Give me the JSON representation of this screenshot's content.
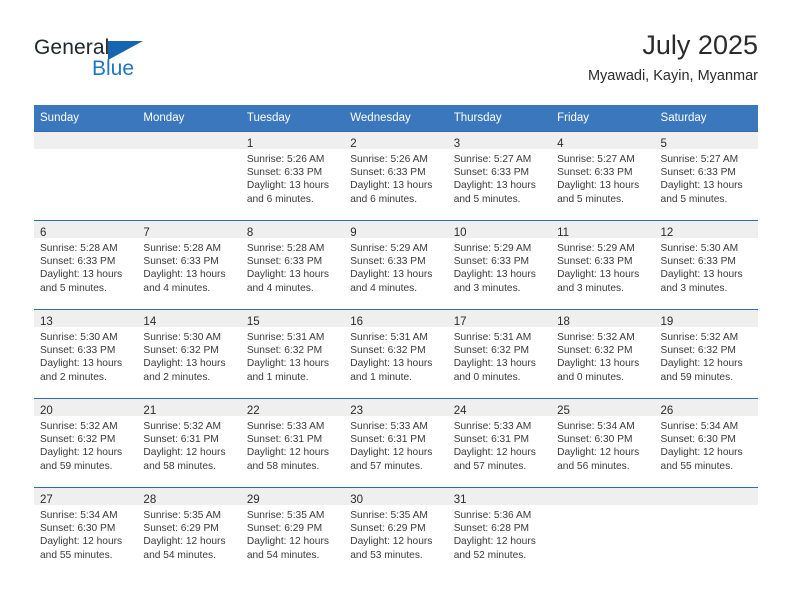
{
  "brand": {
    "name_part1": "General",
    "name_part2": "Blue",
    "triangle_icon": "triangle-icon",
    "accent_color": "#1d77c4"
  },
  "header": {
    "month_title": "July 2025",
    "location": "Myawadi, Kayin, Myanmar"
  },
  "calendar": {
    "header_color": "#3b77bc",
    "separator_color": "#2f6cad",
    "daynum_band_color": "#efefef",
    "weekday_headers": [
      "Sunday",
      "Monday",
      "Tuesday",
      "Wednesday",
      "Thursday",
      "Friday",
      "Saturday"
    ],
    "weeks": [
      [
        {
          "day": "",
          "lines": []
        },
        {
          "day": "",
          "lines": []
        },
        {
          "day": "1",
          "lines": [
            "Sunrise: 5:26 AM",
            "Sunset: 6:33 PM",
            "Daylight: 13 hours",
            "and 6 minutes."
          ]
        },
        {
          "day": "2",
          "lines": [
            "Sunrise: 5:26 AM",
            "Sunset: 6:33 PM",
            "Daylight: 13 hours",
            "and 6 minutes."
          ]
        },
        {
          "day": "3",
          "lines": [
            "Sunrise: 5:27 AM",
            "Sunset: 6:33 PM",
            "Daylight: 13 hours",
            "and 5 minutes."
          ]
        },
        {
          "day": "4",
          "lines": [
            "Sunrise: 5:27 AM",
            "Sunset: 6:33 PM",
            "Daylight: 13 hours",
            "and 5 minutes."
          ]
        },
        {
          "day": "5",
          "lines": [
            "Sunrise: 5:27 AM",
            "Sunset: 6:33 PM",
            "Daylight: 13 hours",
            "and 5 minutes."
          ]
        }
      ],
      [
        {
          "day": "6",
          "lines": [
            "Sunrise: 5:28 AM",
            "Sunset: 6:33 PM",
            "Daylight: 13 hours",
            "and 5 minutes."
          ]
        },
        {
          "day": "7",
          "lines": [
            "Sunrise: 5:28 AM",
            "Sunset: 6:33 PM",
            "Daylight: 13 hours",
            "and 4 minutes."
          ]
        },
        {
          "day": "8",
          "lines": [
            "Sunrise: 5:28 AM",
            "Sunset: 6:33 PM",
            "Daylight: 13 hours",
            "and 4 minutes."
          ]
        },
        {
          "day": "9",
          "lines": [
            "Sunrise: 5:29 AM",
            "Sunset: 6:33 PM",
            "Daylight: 13 hours",
            "and 4 minutes."
          ]
        },
        {
          "day": "10",
          "lines": [
            "Sunrise: 5:29 AM",
            "Sunset: 6:33 PM",
            "Daylight: 13 hours",
            "and 3 minutes."
          ]
        },
        {
          "day": "11",
          "lines": [
            "Sunrise: 5:29 AM",
            "Sunset: 6:33 PM",
            "Daylight: 13 hours",
            "and 3 minutes."
          ]
        },
        {
          "day": "12",
          "lines": [
            "Sunrise: 5:30 AM",
            "Sunset: 6:33 PM",
            "Daylight: 13 hours",
            "and 3 minutes."
          ]
        }
      ],
      [
        {
          "day": "13",
          "lines": [
            "Sunrise: 5:30 AM",
            "Sunset: 6:33 PM",
            "Daylight: 13 hours",
            "and 2 minutes."
          ]
        },
        {
          "day": "14",
          "lines": [
            "Sunrise: 5:30 AM",
            "Sunset: 6:32 PM",
            "Daylight: 13 hours",
            "and 2 minutes."
          ]
        },
        {
          "day": "15",
          "lines": [
            "Sunrise: 5:31 AM",
            "Sunset: 6:32 PM",
            "Daylight: 13 hours",
            "and 1 minute."
          ]
        },
        {
          "day": "16",
          "lines": [
            "Sunrise: 5:31 AM",
            "Sunset: 6:32 PM",
            "Daylight: 13 hours",
            "and 1 minute."
          ]
        },
        {
          "day": "17",
          "lines": [
            "Sunrise: 5:31 AM",
            "Sunset: 6:32 PM",
            "Daylight: 13 hours",
            "and 0 minutes."
          ]
        },
        {
          "day": "18",
          "lines": [
            "Sunrise: 5:32 AM",
            "Sunset: 6:32 PM",
            "Daylight: 13 hours",
            "and 0 minutes."
          ]
        },
        {
          "day": "19",
          "lines": [
            "Sunrise: 5:32 AM",
            "Sunset: 6:32 PM",
            "Daylight: 12 hours",
            "and 59 minutes."
          ]
        }
      ],
      [
        {
          "day": "20",
          "lines": [
            "Sunrise: 5:32 AM",
            "Sunset: 6:32 PM",
            "Daylight: 12 hours",
            "and 59 minutes."
          ]
        },
        {
          "day": "21",
          "lines": [
            "Sunrise: 5:32 AM",
            "Sunset: 6:31 PM",
            "Daylight: 12 hours",
            "and 58 minutes."
          ]
        },
        {
          "day": "22",
          "lines": [
            "Sunrise: 5:33 AM",
            "Sunset: 6:31 PM",
            "Daylight: 12 hours",
            "and 58 minutes."
          ]
        },
        {
          "day": "23",
          "lines": [
            "Sunrise: 5:33 AM",
            "Sunset: 6:31 PM",
            "Daylight: 12 hours",
            "and 57 minutes."
          ]
        },
        {
          "day": "24",
          "lines": [
            "Sunrise: 5:33 AM",
            "Sunset: 6:31 PM",
            "Daylight: 12 hours",
            "and 57 minutes."
          ]
        },
        {
          "day": "25",
          "lines": [
            "Sunrise: 5:34 AM",
            "Sunset: 6:30 PM",
            "Daylight: 12 hours",
            "and 56 minutes."
          ]
        },
        {
          "day": "26",
          "lines": [
            "Sunrise: 5:34 AM",
            "Sunset: 6:30 PM",
            "Daylight: 12 hours",
            "and 55 minutes."
          ]
        }
      ],
      [
        {
          "day": "27",
          "lines": [
            "Sunrise: 5:34 AM",
            "Sunset: 6:30 PM",
            "Daylight: 12 hours",
            "and 55 minutes."
          ]
        },
        {
          "day": "28",
          "lines": [
            "Sunrise: 5:35 AM",
            "Sunset: 6:29 PM",
            "Daylight: 12 hours",
            "and 54 minutes."
          ]
        },
        {
          "day": "29",
          "lines": [
            "Sunrise: 5:35 AM",
            "Sunset: 6:29 PM",
            "Daylight: 12 hours",
            "and 54 minutes."
          ]
        },
        {
          "day": "30",
          "lines": [
            "Sunrise: 5:35 AM",
            "Sunset: 6:29 PM",
            "Daylight: 12 hours",
            "and 53 minutes."
          ]
        },
        {
          "day": "31",
          "lines": [
            "Sunrise: 5:36 AM",
            "Sunset: 6:28 PM",
            "Daylight: 12 hours",
            "and 52 minutes."
          ]
        },
        {
          "day": "",
          "lines": []
        },
        {
          "day": "",
          "lines": []
        }
      ]
    ]
  }
}
